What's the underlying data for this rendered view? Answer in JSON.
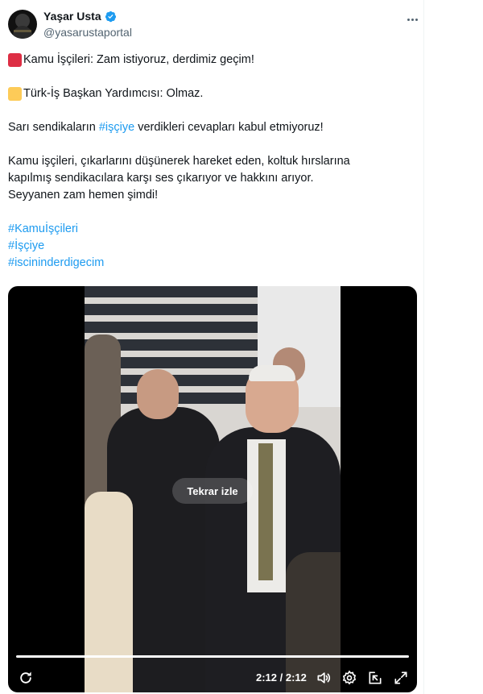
{
  "author": {
    "display_name": "Yaşar Usta",
    "handle": "@yasarustaportal",
    "verified": true
  },
  "icons": {
    "avatar": "profile-photo",
    "verified": "verified-badge-icon",
    "more": "more-horizontal-icon",
    "red_square": "red-square-emoji",
    "yellow_square": "yellow-square-emoji",
    "replay": "replay-icon",
    "volume": "volume-icon",
    "settings": "settings-gear-icon",
    "pip": "picture-in-picture-icon",
    "fullscreen": "fullscreen-icon"
  },
  "colors": {
    "link": "#1d9bf0",
    "verified": "#1d9bf0",
    "text": "#0f1419",
    "muted": "#536471",
    "red_square": "#dd2e44",
    "yellow_square": "#fdcb58"
  },
  "tweet": {
    "line1": "Kamu İşçileri: Zam istiyoruz, derdimiz geçim!",
    "line2": "Türk-İş Başkan Yardımcısı: Olmaz.",
    "line3_pre": "Sarı sendikaların ",
    "line3_link": "#işçiye",
    "line3_post": " verdikleri cevapları kabul etmiyoruz!",
    "para4_l1": "Kamu işçileri, çıkarlarını düşünerek hareket eden, koltuk hırslarına",
    "para4_l2": "kapılmış sendikacılara karşı ses çıkarıyor ve hakkını arıyor.",
    "para4_l3": "Seyyanen zam hemen şimdi!",
    "hashtags": [
      "#Kamuİşçileri",
      "#İşçiye",
      "#iscininderdigecim"
    ]
  },
  "video": {
    "replay_label": "Tekrar izle",
    "time": "2:12 / 2:12",
    "progress": 1.0
  }
}
